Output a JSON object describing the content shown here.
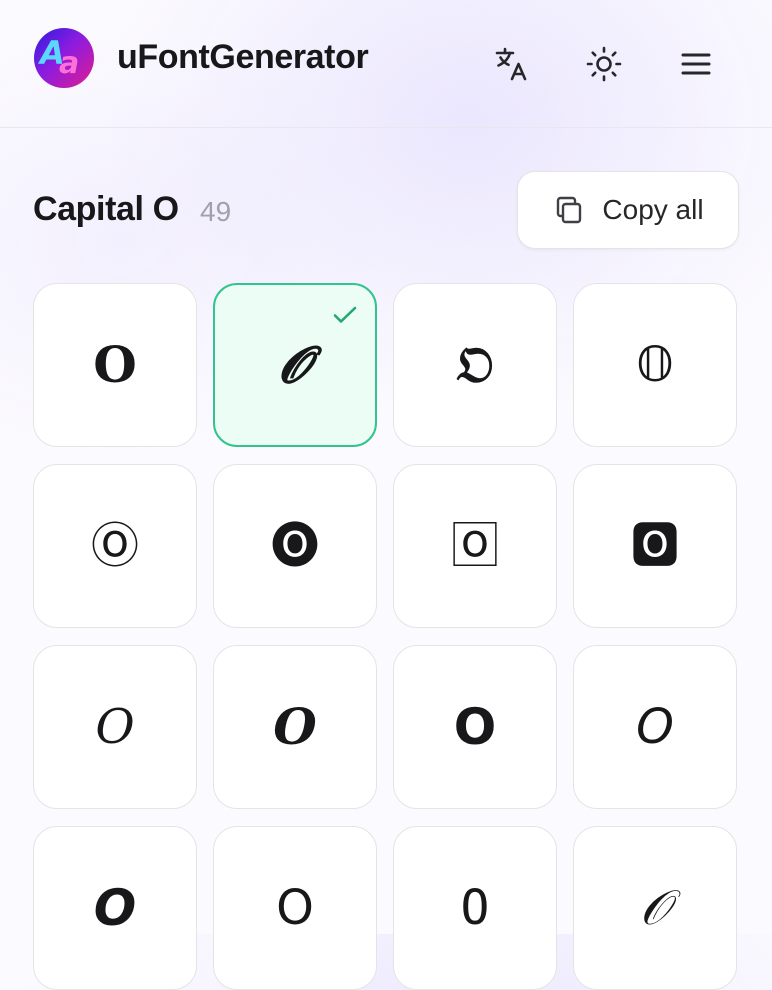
{
  "app": {
    "title": "uFontGenerator",
    "logo_text": "Aa"
  },
  "header": {
    "icons": [
      "translate-icon",
      "sun-icon",
      "menu-icon"
    ]
  },
  "section": {
    "title": "Capital O",
    "count": "49",
    "copy_all_label": "Copy all"
  },
  "grid": {
    "selected_index": 1,
    "cells": [
      {
        "glyph": "𝐎",
        "style": "bold-serif"
      },
      {
        "glyph": "𝓞",
        "style": "bold-script"
      },
      {
        "glyph": "𝔒",
        "style": "fraktur"
      },
      {
        "glyph": "𝕆",
        "style": "double-struck"
      },
      {
        "glyph": "Ⓞ",
        "style": "circled"
      },
      {
        "glyph": "🅞",
        "style": "negative-circled"
      },
      {
        "glyph": "🄾",
        "style": "squared"
      },
      {
        "glyph": "🅾",
        "style": "negative-squared"
      },
      {
        "glyph": "𝑂",
        "style": "italic-serif"
      },
      {
        "glyph": "𝑶",
        "style": "bold-italic-serif"
      },
      {
        "glyph": "𝗢",
        "style": "bold-sans"
      },
      {
        "glyph": "𝘖",
        "style": "italic-sans"
      },
      {
        "glyph": "𝙊",
        "style": "bold-italic-sans"
      },
      {
        "glyph": "𝖮",
        "style": "sans"
      },
      {
        "glyph": "𝙾",
        "style": "monospace"
      },
      {
        "glyph": "𝒪",
        "style": "script"
      }
    ]
  },
  "colors": {
    "selected_border": "#34c38f",
    "selected_bg": "#ecfdf5",
    "text": "#18181b",
    "muted": "#a1a1aa"
  }
}
